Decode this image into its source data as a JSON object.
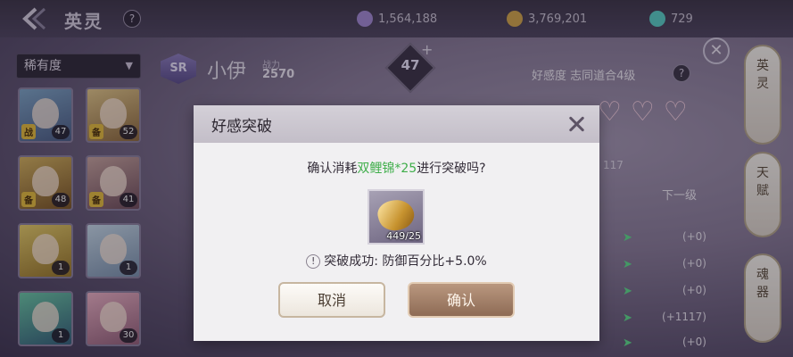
{
  "header": {
    "title": "英灵",
    "help": "?",
    "resources": [
      {
        "icon": "crystal-icon",
        "value": "1,564,188",
        "color": "#a58bd6"
      },
      {
        "icon": "gold-coin-icon",
        "value": "3,769,201",
        "color": "#d6a84a"
      },
      {
        "icon": "gem-icon",
        "value": "729",
        "color": "#5ad2c8"
      }
    ]
  },
  "filter": {
    "label": "稀有度"
  },
  "hero_list": [
    {
      "level": "47",
      "tag": "战"
    },
    {
      "level": "52",
      "tag": "备"
    },
    {
      "level": "48",
      "tag": "备"
    },
    {
      "level": "41",
      "tag": "备"
    },
    {
      "level": "1",
      "tag": ""
    },
    {
      "level": "1",
      "tag": ""
    },
    {
      "level": "1",
      "tag": ""
    },
    {
      "level": "30",
      "tag": ""
    }
  ],
  "hero_detail": {
    "rarity": "SR",
    "name": "小伊",
    "power_label": "战力",
    "power": "2570",
    "star_level": "47",
    "plus": "+"
  },
  "favor_panel": {
    "title": "好感度 志同道合4级",
    "help": "?",
    "hearts": "♡♡♡",
    "exp": "117",
    "next_level": "下一级",
    "stats": [
      "(+0)",
      "(+0)",
      "(+0)",
      "(+1117)",
      "(+0)"
    ]
  },
  "side_tabs": [
    {
      "chars": [
        "英",
        "灵"
      ]
    },
    {
      "chars": [
        "天",
        "赋"
      ]
    },
    {
      "chars": [
        "魂",
        "器"
      ]
    }
  ],
  "modal": {
    "title": "好感突破",
    "confirm_prefix": "确认消耗",
    "item_name": "双鲤锦*25",
    "confirm_suffix": "进行突破吗?",
    "item_count": "449/25",
    "success_icon": "!",
    "success_text": "突破成功: 防御百分比+5.0%",
    "cancel_label": "取消",
    "ok_label": "确认"
  }
}
